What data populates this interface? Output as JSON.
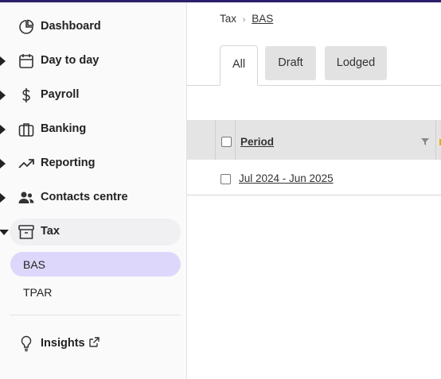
{
  "sidebar": {
    "items": [
      {
        "label": "Dashboard",
        "icon": "pie-chart-icon",
        "expandable": false
      },
      {
        "label": "Day to day",
        "icon": "calendar-icon",
        "expandable": true
      },
      {
        "label": "Payroll",
        "icon": "dollar-icon",
        "expandable": true
      },
      {
        "label": "Banking",
        "icon": "briefcase-icon",
        "expandable": true
      },
      {
        "label": "Reporting",
        "icon": "trend-up-icon",
        "expandable": true
      },
      {
        "label": "Contacts centre",
        "icon": "people-icon",
        "expandable": true
      },
      {
        "label": "Tax",
        "icon": "archive-icon",
        "expandable": true,
        "expanded": true
      }
    ],
    "sub_items": [
      {
        "label": "BAS",
        "selected": true
      },
      {
        "label": "TPAR",
        "selected": false
      }
    ],
    "insights": {
      "label": "Insights",
      "icon": "lightbulb-icon",
      "external": true
    }
  },
  "breadcrumb": {
    "items": [
      "Tax",
      "BAS"
    ]
  },
  "tabs": [
    {
      "label": "All",
      "active": true
    },
    {
      "label": "Draft",
      "active": false
    },
    {
      "label": "Lodged",
      "active": false
    }
  ],
  "table": {
    "columns": [
      {
        "label": "Period",
        "sortable": true,
        "filterable": true
      }
    ],
    "rows": [
      {
        "period": "Jul 2024 - Jun 2025"
      }
    ]
  },
  "colors": {
    "accent_selected": "#ddd8fb",
    "topbar": "#2e1f6b",
    "header_bg": "#e4e4e4"
  }
}
